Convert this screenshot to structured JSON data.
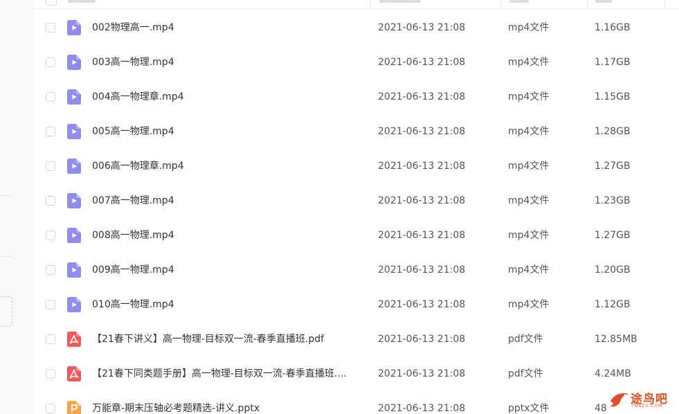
{
  "colors": {
    "video_icon": "#8f8cf0",
    "pdf_icon": "#f25a5a",
    "ppt_icon": "#f7a44a",
    "watermark": "#e0502a"
  },
  "files": [
    {
      "name": "002物理高一.mp4",
      "date": "2021-06-13 21:08",
      "type": "mp4文件",
      "size": "1.16GB",
      "icon": "video-file-icon"
    },
    {
      "name": "003高一物理.mp4",
      "date": "2021-06-13 21:08",
      "type": "mp4文件",
      "size": "1.17GB",
      "icon": "video-file-icon"
    },
    {
      "name": "004高一物理章.mp4",
      "date": "2021-06-13 21:08",
      "type": "mp4文件",
      "size": "1.15GB",
      "icon": "video-file-icon"
    },
    {
      "name": "005高一物理.mp4",
      "date": "2021-06-13 21:08",
      "type": "mp4文件",
      "size": "1.28GB",
      "icon": "video-file-icon"
    },
    {
      "name": "006高一物理章.mp4",
      "date": "2021-06-13 21:08",
      "type": "mp4文件",
      "size": "1.27GB",
      "icon": "video-file-icon"
    },
    {
      "name": "007高一物理.mp4",
      "date": "2021-06-13 21:08",
      "type": "mp4文件",
      "size": "1.23GB",
      "icon": "video-file-icon"
    },
    {
      "name": "008高一物理.mp4",
      "date": "2021-06-13 21:08",
      "type": "mp4文件",
      "size": "1.27GB",
      "icon": "video-file-icon"
    },
    {
      "name": "009高一物理.mp4",
      "date": "2021-06-13 21:08",
      "type": "mp4文件",
      "size": "1.20GB",
      "icon": "video-file-icon"
    },
    {
      "name": "010高一物理.mp4",
      "date": "2021-06-13 21:08",
      "type": "mp4文件",
      "size": "1.12GB",
      "icon": "video-file-icon"
    },
    {
      "name": "【21春下讲义】高一物理-目标双一流-春季直播班.pdf",
      "date": "2021-06-13 21:08",
      "type": "pdf文件",
      "size": "12.85MB",
      "icon": "pdf-file-icon"
    },
    {
      "name": "【21春下同类题手册】高一物理-目标双一流-春季直播班....",
      "date": "2021-06-13 21:08",
      "type": "pdf文件",
      "size": "4.24MB",
      "icon": "pdf-file-icon"
    },
    {
      "name": "万能章-期末压轴必考题精选-讲义.pptx",
      "date": "2021-06-13 21:08",
      "type": "pptx文件",
      "size": "48",
      "icon": "ppt-file-icon"
    }
  ],
  "watermark": {
    "text": "途鸟吧",
    "sub": "TNBZS.COM"
  }
}
